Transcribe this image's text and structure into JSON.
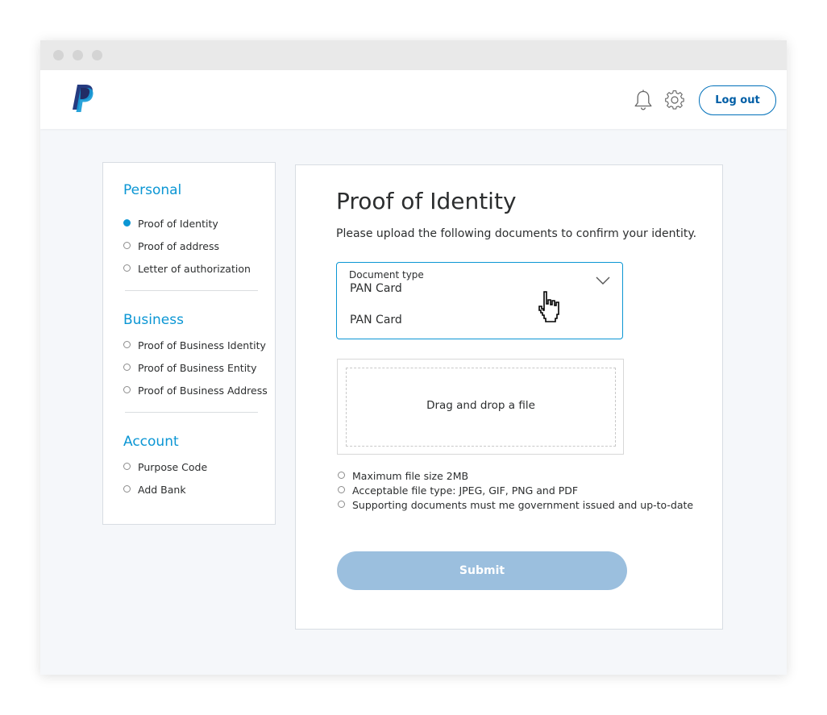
{
  "header": {
    "logo": "paypal-logo",
    "icons": [
      "bell-icon",
      "gear-icon"
    ],
    "logout_label": "Log out"
  },
  "sidebar": {
    "sections": [
      {
        "title": "Personal",
        "items": [
          {
            "label": "Proof of Identity",
            "active": true
          },
          {
            "label": "Proof of address",
            "active": false
          },
          {
            "label": "Letter of authorization",
            "active": false
          }
        ]
      },
      {
        "title": "Business",
        "items": [
          {
            "label": "Proof of Business Identity",
            "active": false
          },
          {
            "label": "Proof of Business Entity",
            "active": false
          },
          {
            "label": "Proof of Business Address",
            "active": false
          }
        ]
      },
      {
        "title": "Account",
        "items": [
          {
            "label": "Purpose Code",
            "active": false
          },
          {
            "label": "Add Bank",
            "active": false
          }
        ]
      }
    ]
  },
  "main": {
    "title": "Proof of Identity",
    "subtitle": "Please upload the following documents to confirm your identity.",
    "document_type": {
      "label": "Document type",
      "value": "PAN Card",
      "options": [
        "PAN Card"
      ]
    },
    "dropzone_label": "Drag and drop a file",
    "requirements": [
      "Maximum file size 2MB",
      "Acceptable file type: JPEG, GIF, PNG and PDF",
      "Supporting documents must me government issued and up-to-date"
    ],
    "submit_label": "Submit"
  },
  "colors": {
    "accent": "#0b96d4",
    "brand_dark": "#253b80",
    "brand_light": "#179bd7",
    "button_disabled": "#9bbfde"
  }
}
